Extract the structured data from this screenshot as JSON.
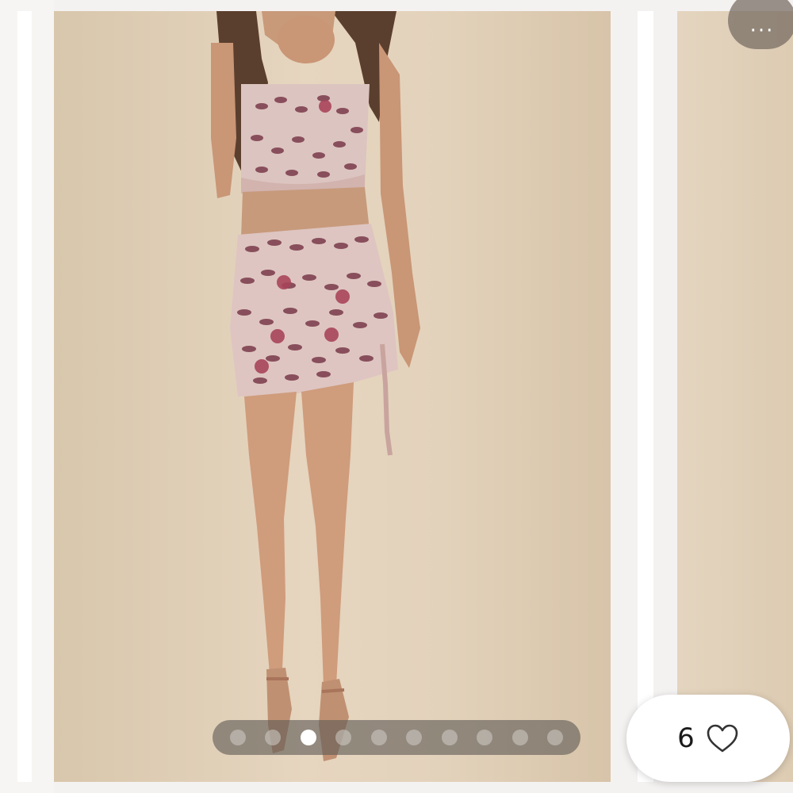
{
  "gallery": {
    "images_total": 10,
    "active_index": 2,
    "more_label": "···"
  },
  "likes": {
    "count": "6"
  },
  "icons": {
    "more": "more-dots-icon",
    "like": "heart-outline-icon"
  },
  "colors": {
    "pagination_bg": "#605a56",
    "active_dot": "#ffffff",
    "like_pill": "#ffffff"
  }
}
